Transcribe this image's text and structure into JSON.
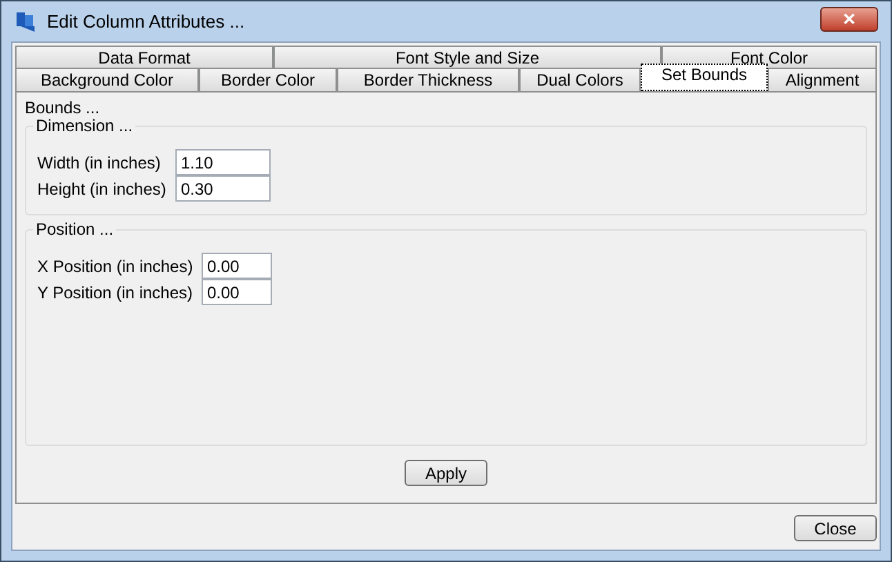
{
  "window": {
    "title": "Edit Column Attributes ...",
    "close_symbol": "✕"
  },
  "tab_rows": [
    [
      {
        "label": "Data Format",
        "selected": false
      },
      {
        "label": "Font Style and Size",
        "selected": false
      },
      {
        "label": "Font Color",
        "selected": false
      }
    ],
    [
      {
        "label": "Background Color",
        "selected": false
      },
      {
        "label": "Border Color",
        "selected": false
      },
      {
        "label": "Border Thickness",
        "selected": false
      },
      {
        "label": "Dual Colors",
        "selected": false
      },
      {
        "label": "Set Bounds",
        "selected": true
      },
      {
        "label": "Alignment",
        "selected": false
      }
    ]
  ],
  "panel": {
    "title": "Bounds ...",
    "groups": [
      {
        "title": "Dimension ...",
        "fields": [
          {
            "label": "Width (in inches)",
            "value": "1.10"
          },
          {
            "label": "Height (in inches)",
            "value": "0.30"
          }
        ]
      },
      {
        "title": "Position ...",
        "fields": [
          {
            "label": "X Position (in inches)",
            "value": "0.00"
          },
          {
            "label": "Y Position (in inches)",
            "value": "0.00"
          }
        ]
      }
    ],
    "apply_button": "Apply"
  },
  "close_button": "Close"
}
